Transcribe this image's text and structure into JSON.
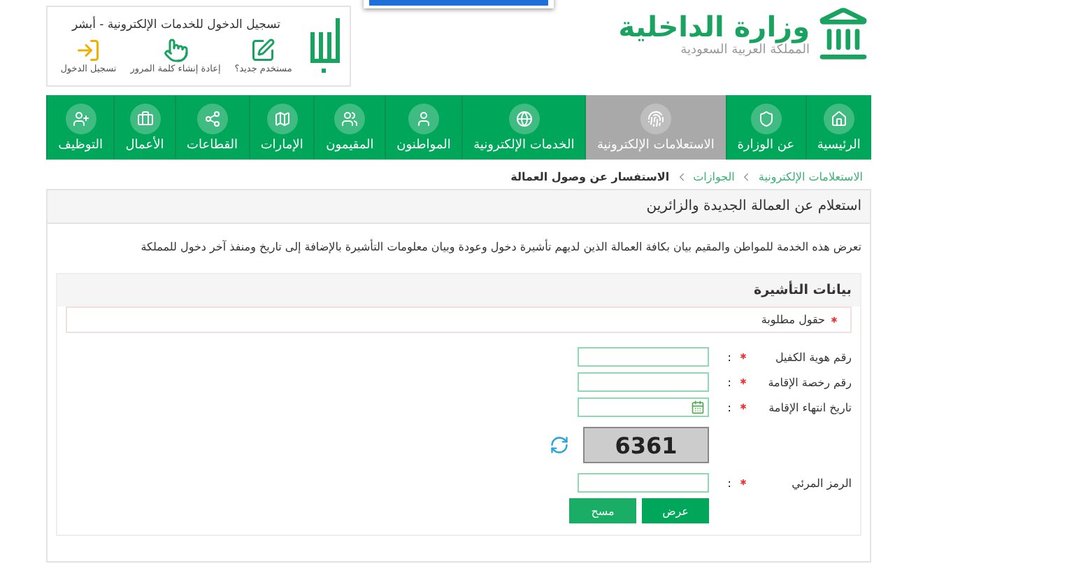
{
  "header": {
    "ministry_name": "وزارة الداخلية",
    "country": "المملكة العربية السعودية"
  },
  "login_box": {
    "title": "تسجيل الدخول للخدمات الإلكترونية - أبشر",
    "actions": [
      {
        "label": "مستخدم جديد؟",
        "kind": "new"
      },
      {
        "label": "إعادة إنشاء كلمة المرور",
        "kind": "reset"
      },
      {
        "label": "تسجيل الدخول",
        "kind": "login"
      }
    ]
  },
  "nav": [
    {
      "label": "الرئيسية",
      "kind": "home",
      "selected": false
    },
    {
      "label": "عن الوزارة",
      "kind": "emblem",
      "selected": false
    },
    {
      "label": "الاستعلامات الإلكترونية",
      "kind": "inquiry",
      "selected": true
    },
    {
      "label": "الخدمات الإلكترونية",
      "kind": "globe",
      "selected": false
    },
    {
      "label": "المواطنون",
      "kind": "citizen",
      "selected": false
    },
    {
      "label": "المقيمون",
      "kind": "residents",
      "selected": false
    },
    {
      "label": "الإمارات",
      "kind": "emirates",
      "selected": false
    },
    {
      "label": "القطاعات",
      "kind": "sectors",
      "selected": false
    },
    {
      "label": "الأعمال",
      "kind": "business",
      "selected": false
    },
    {
      "label": "التوظيف",
      "kind": "jobs",
      "selected": false
    }
  ],
  "breadcrumb": [
    {
      "label": "الاستعلامات الإلكترونية",
      "current": false
    },
    {
      "label": "الجوازات",
      "current": false
    },
    {
      "label": "الاستفسار عن وصول العمالة",
      "current": true
    }
  ],
  "panel": {
    "title": "استعلام عن العمالة الجديدة والزائرين",
    "description": "تعرض هذه الخدمة للمواطن والمقيم بيان بكافة العمالة الذين لديهم تأشيرة دخول وعودة وبيان معلومات التأشيرة بالإضافة إلى تاريخ ومنفذ آخر دخول للمملكة"
  },
  "form": {
    "title": "بيانات التأشيرة",
    "required_note": "حقول مطلوبة",
    "fields": [
      {
        "label": "رقم هوية الكفيل",
        "kind": "text",
        "required": true,
        "separator": ":"
      },
      {
        "label": "رقم رخصة الإقامة",
        "kind": "text",
        "required": true,
        "separator": ":"
      },
      {
        "label": "تاريخ انتهاء الإقامة",
        "kind": "date",
        "required": true,
        "separator": ":"
      },
      {
        "kind": "captcha",
        "captcha": "6361"
      },
      {
        "label": "الرمز المرئي",
        "kind": "text",
        "required": true,
        "separator": ":"
      }
    ],
    "buttons": [
      {
        "label": "عرض",
        "kind": "submit"
      },
      {
        "label": "مسح",
        "kind": "clear"
      }
    ]
  }
}
